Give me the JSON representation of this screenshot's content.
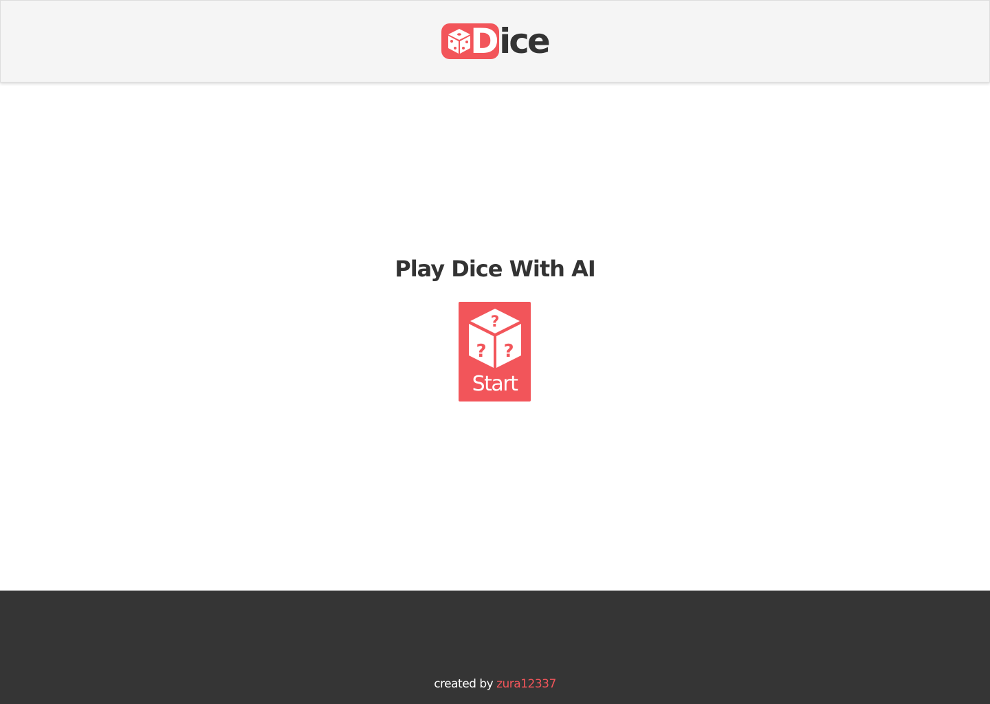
{
  "header": {
    "logo": {
      "icon": "dice-icon",
      "first_letter": "D",
      "rest": "ice"
    }
  },
  "main": {
    "title": "Play Dice With AI",
    "start_button": {
      "icon": "mystery-dice-icon",
      "label": "Start"
    }
  },
  "footer": {
    "credit_prefix": "created by",
    "author": "zura12337"
  },
  "colors": {
    "accent": "#f2555a",
    "header_bg": "#f5f5f5",
    "footer_bg": "#353535",
    "text": "#333333"
  }
}
